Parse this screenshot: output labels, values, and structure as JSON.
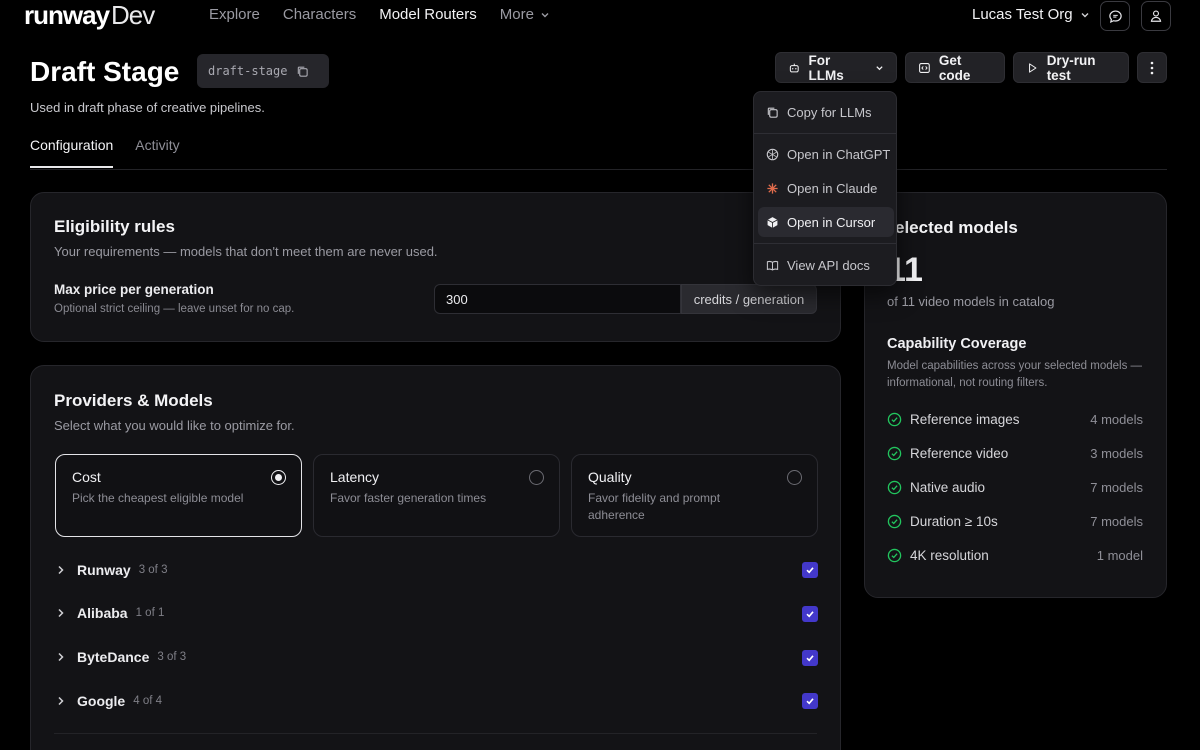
{
  "nav": {
    "logo": "runway",
    "logo_suffix": "Dev",
    "links": [
      "Explore",
      "Characters",
      "Model Routers",
      "More"
    ],
    "org": "Lucas Test Org"
  },
  "header": {
    "title": "Draft Stage",
    "slug": "draft-stage",
    "subtitle": "Used in draft phase of creative pipelines.",
    "for_llms": "For LLMs",
    "get_code": "Get code",
    "dry_run": "Dry-run test"
  },
  "tabs": [
    "Configuration",
    "Activity"
  ],
  "eligibility": {
    "title": "Eligibility rules",
    "subtitle": "Your requirements — models that don't meet them are never used.",
    "max_price_label": "Max price per generation",
    "max_price_help": "Optional strict ceiling — leave unset for no cap.",
    "max_price_value": "300",
    "suffix": "credits / generation"
  },
  "providers": {
    "title": "Providers & Models",
    "subtitle": "Select what you would like to optimize for.",
    "options": [
      {
        "title": "Cost",
        "desc": "Pick the cheapest eligible model",
        "selected": true
      },
      {
        "title": "Latency",
        "desc": "Favor faster generation times",
        "selected": false
      },
      {
        "title": "Quality",
        "desc": "Favor fidelity and prompt adherence",
        "selected": false
      }
    ],
    "list": [
      {
        "name": "Runway",
        "count": "3 of 3",
        "checked": true
      },
      {
        "name": "Alibaba",
        "count": "1 of 1",
        "checked": true
      },
      {
        "name": "ByteDance",
        "count": "3 of 3",
        "checked": true
      },
      {
        "name": "Google",
        "count": "4 of 4",
        "checked": true
      }
    ]
  },
  "selected": {
    "title": "elected models",
    "number": "11",
    "catalog": "of 11 video models in catalog",
    "coverage_title": "Capability Coverage",
    "coverage_desc": "Model capabilities across your selected models — informational, not routing filters.",
    "capabilities": [
      {
        "name": "Reference images",
        "count": "4 models"
      },
      {
        "name": "Reference video",
        "count": "3 models"
      },
      {
        "name": "Native audio",
        "count": "7 models"
      },
      {
        "name": "Duration ≥ 10s",
        "count": "7 models"
      },
      {
        "name": "4K resolution",
        "count": "1 model"
      }
    ]
  },
  "menu": {
    "items": [
      "Copy for LLMs",
      "Open in ChatGPT",
      "Open in Claude",
      "Open in Cursor",
      "View API docs"
    ],
    "hovered": "Open in Cursor"
  },
  "colors": {
    "accent_check": "#4338ca",
    "capability_check": "#22c55e",
    "claude_icon": "#e06c4c"
  }
}
